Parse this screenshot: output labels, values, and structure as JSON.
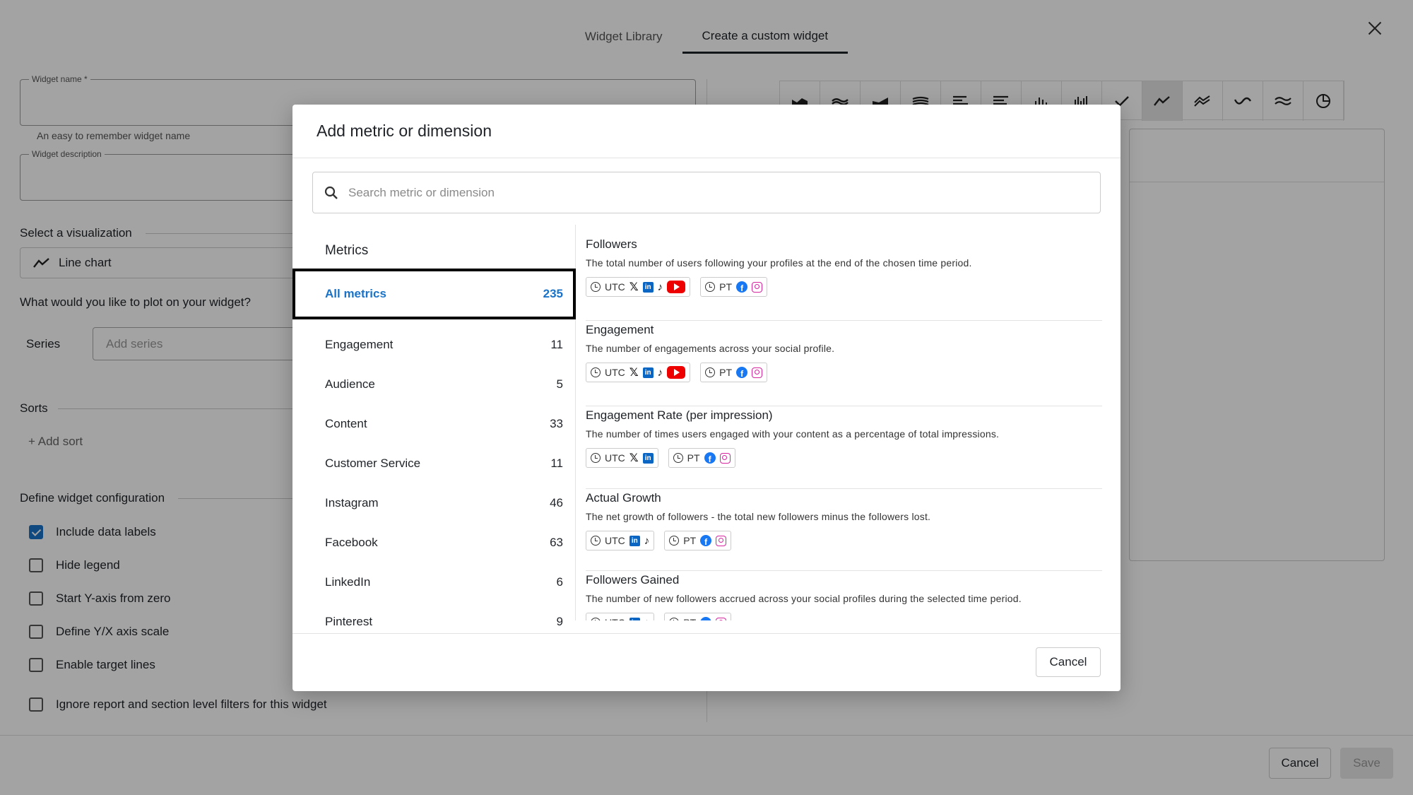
{
  "tabs": [
    "Widget Library",
    "Create a custom widget"
  ],
  "form": {
    "widget_name_label": "Widget name *",
    "widget_name_helper": "An easy to remember widget name",
    "widget_description_label": "Widget description",
    "visualization_label": "Select a visualization",
    "visualization_value": "Line chart",
    "plot_label": "What would you like to plot on your widget?",
    "series_label": "Series",
    "series_placeholder": "Add series",
    "sorts_label": "Sorts",
    "add_sort": "Add sort",
    "config_label": "Define widget configuration",
    "checkboxes": [
      {
        "label": "Include data labels",
        "checked": true
      },
      {
        "label": "Hide legend",
        "checked": false
      },
      {
        "label": "Start Y-axis from zero",
        "checked": false
      },
      {
        "label": "Define Y/X axis scale",
        "checked": false
      },
      {
        "label": "Enable target lines",
        "checked": false
      },
      {
        "label": "Ignore report and section level filters for this widget",
        "checked": false
      }
    ]
  },
  "footer": {
    "cancel": "Cancel",
    "save": "Save"
  },
  "modal": {
    "title": "Add metric or dimension",
    "search_placeholder": "Search metric or dimension",
    "categories_heading": "Metrics",
    "categories": [
      {
        "label": "All metrics",
        "count": "235"
      },
      {
        "label": "Engagement",
        "count": "11"
      },
      {
        "label": "Audience",
        "count": "5"
      },
      {
        "label": "Content",
        "count": "33"
      },
      {
        "label": "Customer Service",
        "count": "11"
      },
      {
        "label": "Instagram",
        "count": "46"
      },
      {
        "label": "Facebook",
        "count": "63"
      },
      {
        "label": "LinkedIn",
        "count": "6"
      },
      {
        "label": "Pinterest",
        "count": "9"
      }
    ],
    "metrics": [
      {
        "name": "Followers",
        "description": "The total number of users following your profiles at the end of the chosen time period.",
        "utc_platforms": [
          "x",
          "linkedin",
          "tiktok",
          "youtube"
        ],
        "pt_platforms": [
          "facebook",
          "instagram"
        ]
      },
      {
        "name": "Engagement",
        "description": "The number of engagements across your social profile.",
        "utc_platforms": [
          "x",
          "linkedin",
          "tiktok",
          "youtube"
        ],
        "pt_platforms": [
          "facebook",
          "instagram"
        ]
      },
      {
        "name": "Engagement Rate (per impression)",
        "description": "The number of times users engaged with your content as a percentage of total impressions.",
        "utc_platforms": [
          "x",
          "linkedin"
        ],
        "pt_platforms": [
          "facebook",
          "instagram"
        ]
      },
      {
        "name": "Actual Growth",
        "description": "The net growth of followers - the total new followers minus the followers lost.",
        "utc_platforms": [
          "linkedin",
          "tiktok"
        ],
        "pt_platforms": [
          "facebook",
          "instagram"
        ]
      },
      {
        "name": "Followers Gained",
        "description": "The number of new followers accrued across your social profiles during the selected time period.",
        "utc_platforms": [
          "linkedin",
          "tiktok"
        ],
        "pt_platforms": [
          "facebook",
          "instagram"
        ]
      }
    ],
    "tz_utc": "UTC",
    "tz_pt": "PT",
    "cancel": "Cancel"
  },
  "colors": {
    "accent": "#1a73c8",
    "youtube": "#e00000",
    "facebook": "#1877f2",
    "linkedin": "#0a66c2",
    "instagram": "#d6249f"
  }
}
